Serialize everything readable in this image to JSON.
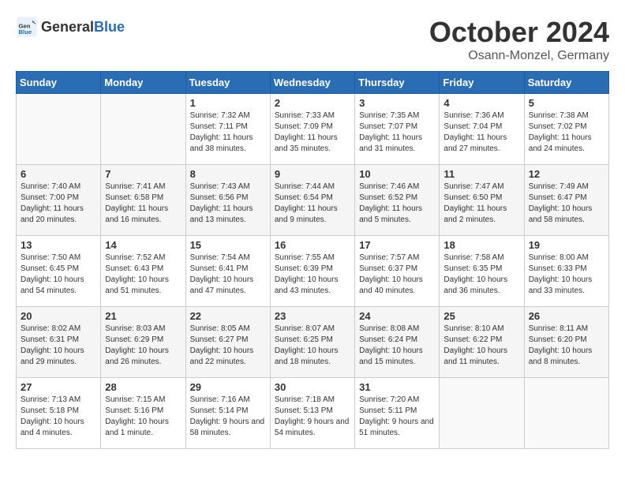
{
  "header": {
    "logo_general": "General",
    "logo_blue": "Blue",
    "title": "October 2024",
    "location": "Osann-Monzel, Germany"
  },
  "weekdays": [
    "Sunday",
    "Monday",
    "Tuesday",
    "Wednesday",
    "Thursday",
    "Friday",
    "Saturday"
  ],
  "weeks": [
    [
      {
        "day": "",
        "info": ""
      },
      {
        "day": "",
        "info": ""
      },
      {
        "day": "1",
        "info": "Sunrise: 7:32 AM\nSunset: 7:11 PM\nDaylight: 11 hours and 38 minutes."
      },
      {
        "day": "2",
        "info": "Sunrise: 7:33 AM\nSunset: 7:09 PM\nDaylight: 11 hours and 35 minutes."
      },
      {
        "day": "3",
        "info": "Sunrise: 7:35 AM\nSunset: 7:07 PM\nDaylight: 11 hours and 31 minutes."
      },
      {
        "day": "4",
        "info": "Sunrise: 7:36 AM\nSunset: 7:04 PM\nDaylight: 11 hours and 27 minutes."
      },
      {
        "day": "5",
        "info": "Sunrise: 7:38 AM\nSunset: 7:02 PM\nDaylight: 11 hours and 24 minutes."
      }
    ],
    [
      {
        "day": "6",
        "info": "Sunrise: 7:40 AM\nSunset: 7:00 PM\nDaylight: 11 hours and 20 minutes."
      },
      {
        "day": "7",
        "info": "Sunrise: 7:41 AM\nSunset: 6:58 PM\nDaylight: 11 hours and 16 minutes."
      },
      {
        "day": "8",
        "info": "Sunrise: 7:43 AM\nSunset: 6:56 PM\nDaylight: 11 hours and 13 minutes."
      },
      {
        "day": "9",
        "info": "Sunrise: 7:44 AM\nSunset: 6:54 PM\nDaylight: 11 hours and 9 minutes."
      },
      {
        "day": "10",
        "info": "Sunrise: 7:46 AM\nSunset: 6:52 PM\nDaylight: 11 hours and 5 minutes."
      },
      {
        "day": "11",
        "info": "Sunrise: 7:47 AM\nSunset: 6:50 PM\nDaylight: 11 hours and 2 minutes."
      },
      {
        "day": "12",
        "info": "Sunrise: 7:49 AM\nSunset: 6:47 PM\nDaylight: 10 hours and 58 minutes."
      }
    ],
    [
      {
        "day": "13",
        "info": "Sunrise: 7:50 AM\nSunset: 6:45 PM\nDaylight: 10 hours and 54 minutes."
      },
      {
        "day": "14",
        "info": "Sunrise: 7:52 AM\nSunset: 6:43 PM\nDaylight: 10 hours and 51 minutes."
      },
      {
        "day": "15",
        "info": "Sunrise: 7:54 AM\nSunset: 6:41 PM\nDaylight: 10 hours and 47 minutes."
      },
      {
        "day": "16",
        "info": "Sunrise: 7:55 AM\nSunset: 6:39 PM\nDaylight: 10 hours and 43 minutes."
      },
      {
        "day": "17",
        "info": "Sunrise: 7:57 AM\nSunset: 6:37 PM\nDaylight: 10 hours and 40 minutes."
      },
      {
        "day": "18",
        "info": "Sunrise: 7:58 AM\nSunset: 6:35 PM\nDaylight: 10 hours and 36 minutes."
      },
      {
        "day": "19",
        "info": "Sunrise: 8:00 AM\nSunset: 6:33 PM\nDaylight: 10 hours and 33 minutes."
      }
    ],
    [
      {
        "day": "20",
        "info": "Sunrise: 8:02 AM\nSunset: 6:31 PM\nDaylight: 10 hours and 29 minutes."
      },
      {
        "day": "21",
        "info": "Sunrise: 8:03 AM\nSunset: 6:29 PM\nDaylight: 10 hours and 26 minutes."
      },
      {
        "day": "22",
        "info": "Sunrise: 8:05 AM\nSunset: 6:27 PM\nDaylight: 10 hours and 22 minutes."
      },
      {
        "day": "23",
        "info": "Sunrise: 8:07 AM\nSunset: 6:25 PM\nDaylight: 10 hours and 18 minutes."
      },
      {
        "day": "24",
        "info": "Sunrise: 8:08 AM\nSunset: 6:24 PM\nDaylight: 10 hours and 15 minutes."
      },
      {
        "day": "25",
        "info": "Sunrise: 8:10 AM\nSunset: 6:22 PM\nDaylight: 10 hours and 11 minutes."
      },
      {
        "day": "26",
        "info": "Sunrise: 8:11 AM\nSunset: 6:20 PM\nDaylight: 10 hours and 8 minutes."
      }
    ],
    [
      {
        "day": "27",
        "info": "Sunrise: 7:13 AM\nSunset: 5:18 PM\nDaylight: 10 hours and 4 minutes."
      },
      {
        "day": "28",
        "info": "Sunrise: 7:15 AM\nSunset: 5:16 PM\nDaylight: 10 hours and 1 minute."
      },
      {
        "day": "29",
        "info": "Sunrise: 7:16 AM\nSunset: 5:14 PM\nDaylight: 9 hours and 58 minutes."
      },
      {
        "day": "30",
        "info": "Sunrise: 7:18 AM\nSunset: 5:13 PM\nDaylight: 9 hours and 54 minutes."
      },
      {
        "day": "31",
        "info": "Sunrise: 7:20 AM\nSunset: 5:11 PM\nDaylight: 9 hours and 51 minutes."
      },
      {
        "day": "",
        "info": ""
      },
      {
        "day": "",
        "info": ""
      }
    ]
  ]
}
